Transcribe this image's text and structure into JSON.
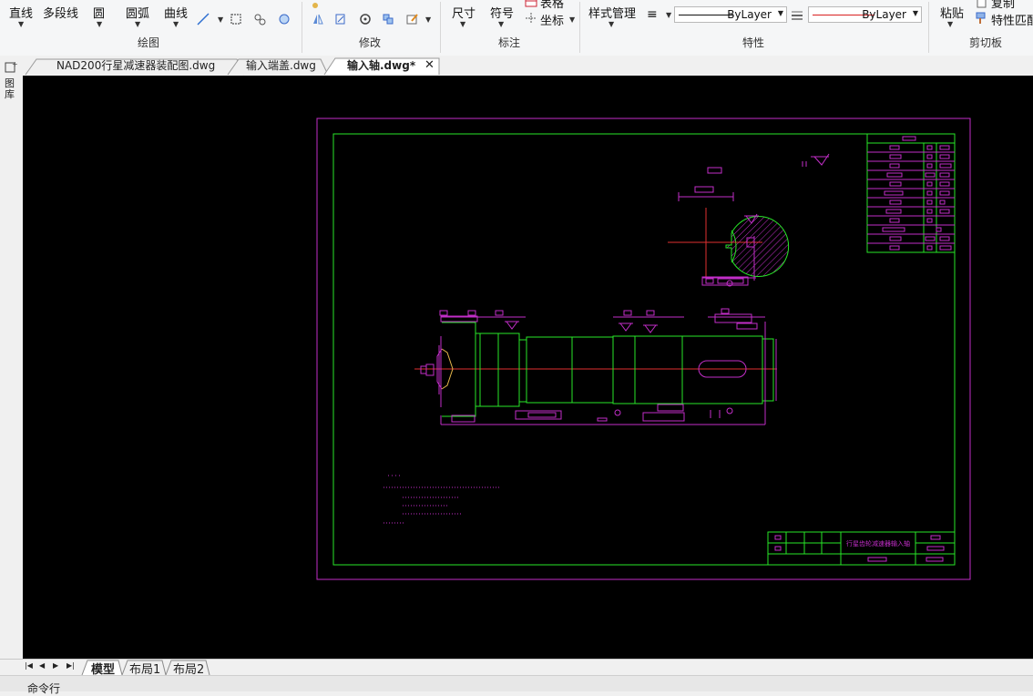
{
  "ribbon": {
    "draw": {
      "line_label": "直线",
      "polyline_label": "多段线",
      "circle_label": "圆",
      "arc_label": "圆弧",
      "curve_label": "曲线",
      "group_label": "绘图"
    },
    "modify": {
      "group_label": "修改"
    },
    "annotate": {
      "dimension_label": "尺寸",
      "symbol_label": "符号",
      "table_label": "表格",
      "coordinate_label": "坐标",
      "group_label": "标注"
    },
    "properties": {
      "style_manager_label": "样式管理",
      "linetype_value": "ByLayer",
      "color_value": "ByLayer",
      "group_label": "特性"
    },
    "clipboard": {
      "paste_label": "粘贴",
      "copy_label": "复制",
      "match_label": "特性匹配",
      "group_label": "剪切板"
    }
  },
  "doc_tabs": [
    {
      "label": "NAD200行星减速器装配图.dwg"
    },
    {
      "label": "输入端盖.dwg"
    },
    {
      "label": "输入轴.dwg*"
    }
  ],
  "side_panel": {
    "label": "图库"
  },
  "drawing": {
    "title_block_name": "行星齿轮减速器输入轴",
    "colors": {
      "frame": "#c22ec8",
      "border": "#28e628",
      "centerline": "#e03030",
      "background": "#000000"
    }
  },
  "layout_tabs": [
    {
      "label": "模型"
    },
    {
      "label": "布局1"
    },
    {
      "label": "布局2"
    }
  ],
  "command_line": {
    "label": "命令行"
  }
}
